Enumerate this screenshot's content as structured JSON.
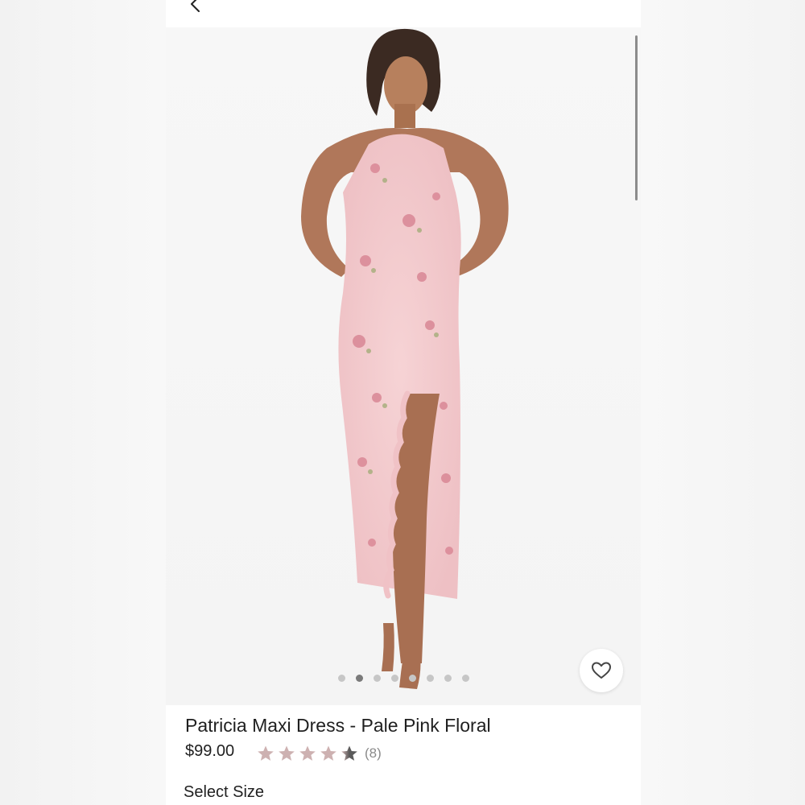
{
  "product": {
    "name": "Patricia Maxi Dress - Pale Pink Floral",
    "price": "$99.00",
    "rating": 4.5,
    "rating_max": 5,
    "review_count": "(8)",
    "select_size_label": "Select Size"
  },
  "gallery": {
    "image_count": 8,
    "active_index": 1
  },
  "icons": {
    "back": "chevron-left-icon",
    "favorite": "heart-outline-icon",
    "star": "star-icon"
  },
  "colors": {
    "star_filled": "#cdb1b1",
    "star_empty": "#e6d9d9",
    "dress": "#f3c9cc",
    "dot_active": "#7a7a7a",
    "dot_inactive": "#c6c6c6"
  }
}
